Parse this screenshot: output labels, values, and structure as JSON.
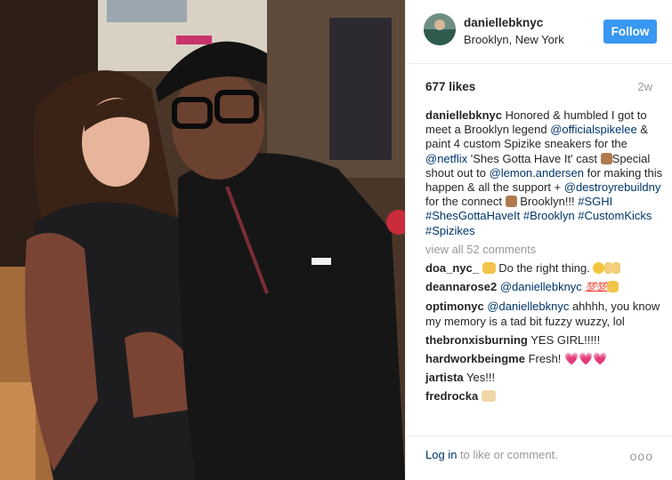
{
  "post": {
    "username": "daniellebknyc",
    "location": "Brooklyn, New York",
    "follow_label": "Follow",
    "likes": "677 likes",
    "age": "2w",
    "caption": {
      "user": "daniellebknyc",
      "t1": " Honored & humbled I got to meet a Brooklyn legend ",
      "m1": "@officialspikelee",
      "t2": " & paint 4 custom Spizike sneakers for the ",
      "m2": "@netflix",
      "t3": " 'Shes Gotta Have It' cast ",
      "t4": "Special shout out to ",
      "m3": "@lemon.andersen",
      "t5": " for making this happen & all the support + ",
      "m4": "@destroyrebuildny",
      "t6": " for the connect ",
      "t7": " Brooklyn!!! ",
      "h1": "#SGHI",
      "h2": "#ShesGottaHaveIt",
      "h3": "#Brooklyn",
      "h4": "#CustomKicks",
      "h5": "#Spizikes"
    },
    "view_all": "view all 52 comments",
    "comments": [
      {
        "user": "doa_nyc_",
        "text": " Do the right thing. "
      },
      {
        "user": "deannarose2",
        "mention": "@daniellebknyc",
        "text": " "
      },
      {
        "user": "optimonyc",
        "mention": "@daniellebknyc",
        "text": " ahhhh, you know my memory is a tad bit fuzzy wuzzy, lol"
      },
      {
        "user": "thebronxisburning",
        "text": " YES GIRL!!!!!"
      },
      {
        "user": "hardworkbeingme",
        "text": " Fresh! "
      },
      {
        "user": "jartista",
        "text": " Yes!!!"
      },
      {
        "user": "fredrocka",
        "text": " "
      }
    ],
    "emoji": {
      "hundred": "💯💯",
      "hearts": "💗💗💗"
    },
    "footer": {
      "login": "Log in",
      "rest": " to like or comment.",
      "more": "ooo"
    }
  },
  "icons": [
    "avatar",
    "more-options-icon"
  ]
}
